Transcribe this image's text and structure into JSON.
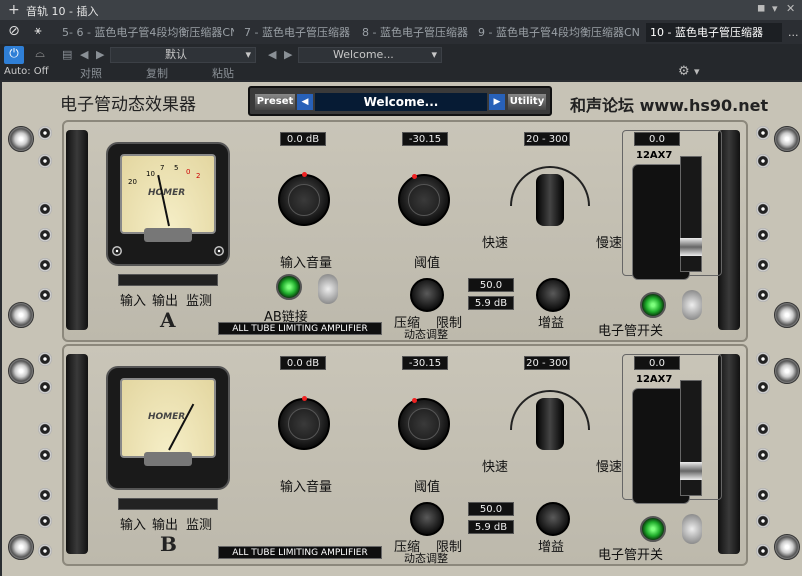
{
  "titlebar": {
    "title": "音轨 10 - 插入",
    "pin": "◼",
    "menu": "▾",
    "close": "✕"
  },
  "tabs": [
    {
      "label": "5- 6 - 蓝色电子管4段均衡压缩器CN"
    },
    {
      "label": "7 - 蓝色电子管压缩器"
    },
    {
      "label": "8 - 蓝色电子管压缩器"
    },
    {
      "label": "9 - 蓝色电子管4段均衡压缩器CN"
    },
    {
      "label": "10 - 蓝色电子管压缩器"
    }
  ],
  "tabs_more": "...",
  "controls": {
    "auto": "Auto: Off",
    "compare": "对照",
    "copy": "复制",
    "paste": "粘贴",
    "preset_value": "默认",
    "preset_display": "Welcome..."
  },
  "plugin": {
    "title": "电子管动态效果器",
    "preset_button": "Preset",
    "preset_name": "Welcome...",
    "utility_button": "Utility",
    "brand": "和声论坛 www.hs90.net",
    "channels": [
      {
        "id": "A",
        "input_db": "0.0 dB",
        "threshold": "-30.15",
        "range": "20 - 300",
        "tube_value": "0.0",
        "tube_name": "12AX7",
        "input_label": "输入音量",
        "threshold_label": "阈值",
        "fast": "快速",
        "slow": "慢速",
        "meter_in": "输入",
        "meter_out": "输出",
        "meter_mon": "监测",
        "ab_link": "AB链接",
        "ratio": "50.0",
        "gain_db": "5.9 dB",
        "compress": "压缩",
        "limit": "限制",
        "dynamics": "动态调整",
        "gain": "增益",
        "db_small": "dB",
        "tube_switch": "电子管开关",
        "amp_text": "ALL TUBE LIMITING AMPLIFIER"
      },
      {
        "id": "B",
        "input_db": "0.0 dB",
        "threshold": "-30.15",
        "range": "20 - 300",
        "tube_value": "0.0",
        "tube_name": "12AX7",
        "input_label": "输入音量",
        "threshold_label": "阈值",
        "fast": "快速",
        "slow": "慢速",
        "meter_in": "输入",
        "meter_out": "输出",
        "meter_mon": "监测",
        "ratio": "50.0",
        "gain_db": "5.9 dB",
        "compress": "压缩",
        "limit": "限制",
        "dynamics": "动态调整",
        "gain": "增益",
        "db_small": "dB",
        "tube_switch": "电子管开关",
        "amp_text": "ALL TUBE LIMITING AMPLIFIER"
      }
    ],
    "vu_brand": "HOMER",
    "vu_scale": [
      "20",
      "10",
      "7",
      "5",
      "3",
      "1",
      "0",
      "1",
      "2",
      "3"
    ]
  }
}
